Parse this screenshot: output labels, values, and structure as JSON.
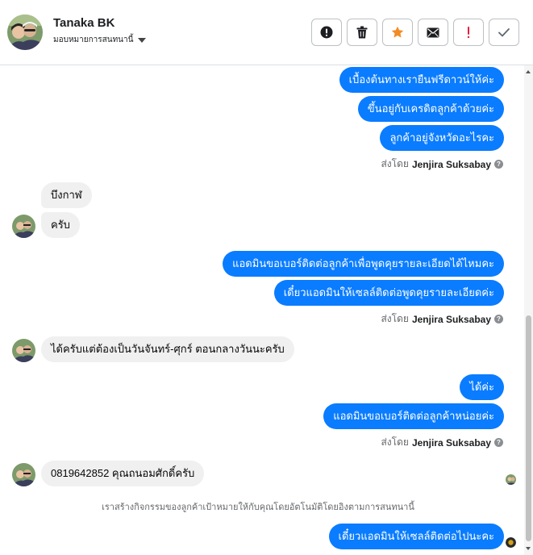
{
  "header": {
    "name": "Tanaka BK",
    "assign_label": "มอบหมายการสนทนานี้"
  },
  "toolbar": [
    {
      "name": "alert-icon",
      "color": "#1c1e21"
    },
    {
      "name": "trash-icon",
      "color": "#1c1e21"
    },
    {
      "name": "star-icon",
      "color": "#f28b25"
    },
    {
      "name": "envelope-icon",
      "color": "#1c1e21"
    },
    {
      "name": "exclamation-icon",
      "color": "#e41e3f"
    },
    {
      "name": "check-icon",
      "color": "#606770"
    }
  ],
  "colors": {
    "outgoing": "#0a7cff",
    "incoming": "#f0f0f0"
  },
  "messages": {
    "m1": "เบื้องต้นทางเรายืนฟรีดาวน์ให้ค่ะ",
    "m2": "ขึ้นอยู่กับเครดิตลูกค้าด้วยค่ะ",
    "m3": "ลูกค้าอยู่จังหวัดอะไรคะ",
    "m4": "บึงกาฬ",
    "m5": "ครับ",
    "m6": "แอดมินขอเบอร์ติดต่อลูกค้าเพื่อพูดคุยรายละเอียดได้ไหมคะ",
    "m7": "เดี๋ยวแอดมินให้เซลล์ติดต่อพูดคุยรายละเอียดค่ะ",
    "m8": "ได้ครับแต่ต้องเป็นวันจันทร์-ศุกร์ ตอนกลางวันนะครับ",
    "m9": "ได้ค่ะ",
    "m10": "แอดมินขอเบอร์ติดต่อลูกค้าหน่อยค่ะ",
    "m11": "0819642852 คุณถนอมศักดิ์ครับ",
    "m12": "เดี๋ยวแอดมินให้เซลล์ติดต่อไปนะคะ"
  },
  "sent_by": {
    "prefix": "ส่งโดย",
    "name": "Jenjira Suksabay",
    "help": "?"
  },
  "system_note": "เราสร้างกิจกรรมของลูกค้าเป้าหมายให้กับคุณโดยอัตโนมัติโดยอิงตามการสนทนานี้"
}
